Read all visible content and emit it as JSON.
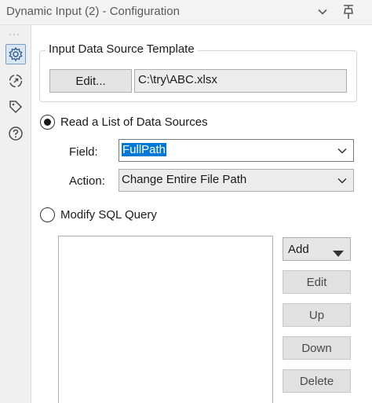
{
  "window": {
    "title": "Dynamic Input (2) - Configuration"
  },
  "sidebar": {
    "items": [
      {
        "icon": "gear-icon"
      },
      {
        "icon": "connection-icon"
      },
      {
        "icon": "tag-icon"
      },
      {
        "icon": "help-icon"
      }
    ]
  },
  "template": {
    "group_label": "Input Data Source Template",
    "edit_label": "Edit...",
    "path_value": "C:\\try\\ABC.xlsx"
  },
  "mode_list": {
    "label": "Read a List of Data Sources",
    "selected": true,
    "field_label": "Field:",
    "field_value": "FullPath",
    "action_label": "Action:",
    "action_value": "Change Entire File Path"
  },
  "mode_sql": {
    "label": "Modify SQL Query",
    "selected": false
  },
  "buttons": {
    "add": "Add",
    "edit": "Edit",
    "up": "Up",
    "down": "Down",
    "delete": "Delete"
  },
  "colors": {
    "selection": "#0078d7",
    "active_tab_border": "#7a9bc4"
  }
}
